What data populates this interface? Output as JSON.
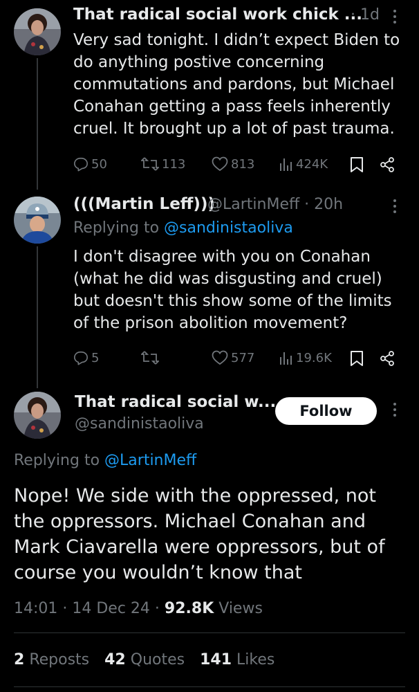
{
  "tweet1": {
    "name": "That radical social work chick ...",
    "time": "· 1d",
    "text": "Very sad tonight. I didn’t expect Biden to do anything postive concerning commutations and pardons, but Michael Conahan getting a pass feels inherently cruel. It brought up a lot of past trauma.",
    "replies": "50",
    "reposts": "113",
    "likes": "813",
    "views": "424K"
  },
  "tweet2": {
    "name": "(((Martin Leff)))",
    "handle_time": "@LartinMeff · 20h",
    "replying_prefix": "Replying to",
    "replying_to": "@sandinistaoliva",
    "text": "I don't disagree with you on Conahan (what he did was disgusting and cruel) but doesn't this show some of the limits of the prison abolition movement?",
    "replies": "5",
    "reposts": "",
    "likes": "577",
    "views": "19.6K"
  },
  "main_tweet": {
    "name": "That radical social w...",
    "handle": "@sandinistaoliva",
    "follow_label": "Follow",
    "replying_prefix": "Replying to",
    "replying_to": "@LartinMeff",
    "text": "Nope! We side with the oppressed, not the oppressors. Michael Conahan and Mark Ciavarella were oppressors, but of course you wouldn’t know that",
    "time_date": "14:01 · 14 Dec 24 ·",
    "views_count": "92.8K",
    "views_label": "Views",
    "reposts_count": "2",
    "reposts_label": "Reposts",
    "quotes_count": "42",
    "quotes_label": "Quotes",
    "likes_count": "141",
    "likes_label": "Likes"
  },
  "icons": {
    "reply": "reply-icon",
    "repost": "repost-icon",
    "like": "heart-icon",
    "views": "views-icon",
    "bookmark": "bookmark-icon",
    "share": "share-icon",
    "more": "more-icon"
  },
  "colors": {
    "background": "#000000",
    "text": "#e7e9ea",
    "muted": "#71767b",
    "link": "#1d9bf0"
  }
}
